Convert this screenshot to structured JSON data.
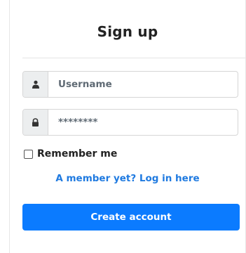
{
  "form": {
    "title": "Sign up",
    "username": {
      "icon": "user-icon",
      "placeholder": "Username",
      "value": ""
    },
    "password": {
      "icon": "lock-icon",
      "placeholder": "********",
      "value": ""
    },
    "remember_label": "Remember me",
    "remember_checked": false,
    "login_link": "A member yet? Log in here",
    "submit_label": "Create account"
  },
  "colors": {
    "primary": "#0b7bff",
    "link": "#1f7ae0",
    "addon_bg": "#eceeef"
  }
}
